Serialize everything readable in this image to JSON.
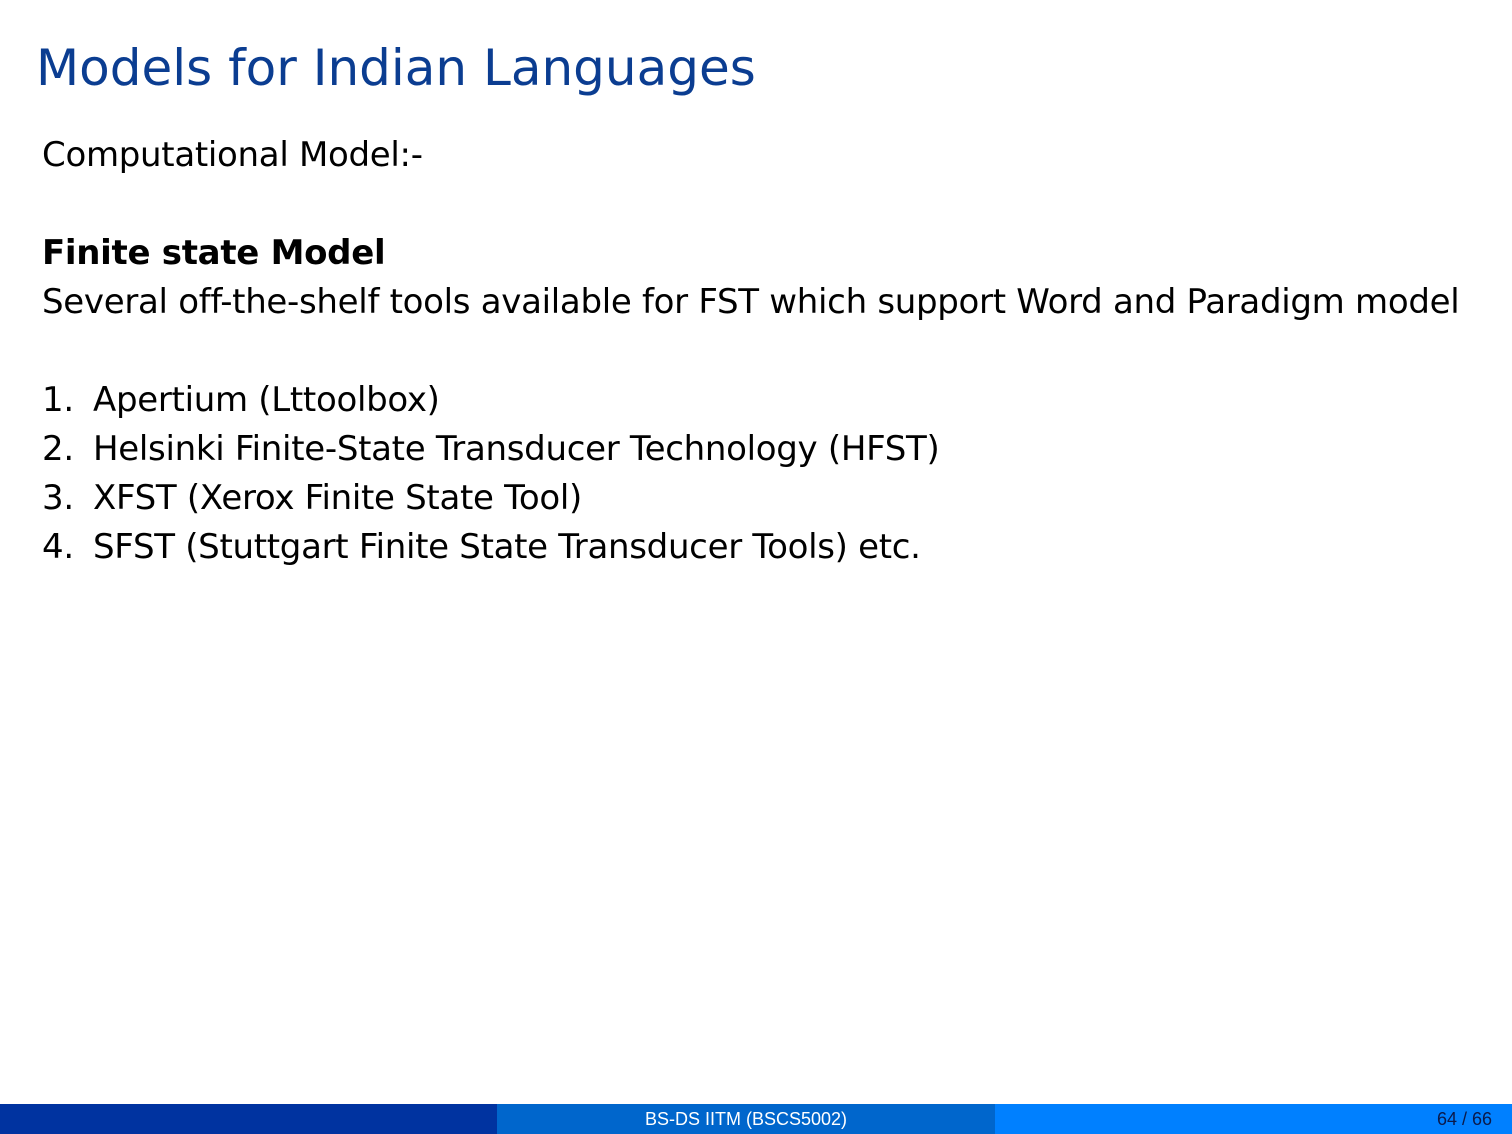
{
  "title": "Models for Indian Languages",
  "intro": "Computational Model:-",
  "section": {
    "heading": "Finite state Model",
    "description": "Several off-the-shelf tools available for FST which support Word and Paradigm model"
  },
  "tools": [
    {
      "num": "1.",
      "text": "Apertium (Lttoolbox)"
    },
    {
      "num": "2.",
      "text": "Helsinki Finite-State Transducer Technology (HFST)"
    },
    {
      "num": "3.",
      "text": "XFST (Xerox Finite State Tool)"
    },
    {
      "num": "4.",
      "text": "SFST (Stuttgart Finite State Transducer Tools) etc."
    }
  ],
  "footer": {
    "center": "BS-DS IITM (BSCS5002)",
    "page": "64 / 66"
  },
  "colors": {
    "title": "#0b3d91",
    "footer_left": "#0033a0",
    "footer_mid": "#0066cc",
    "footer_right": "#0080ff"
  }
}
